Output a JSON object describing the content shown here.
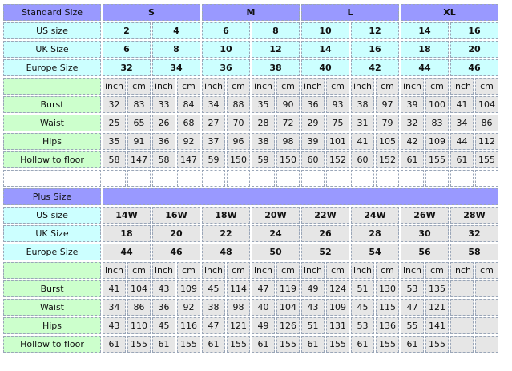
{
  "standard": {
    "title": "Standard Size",
    "groups": [
      "S",
      "M",
      "L",
      "XL"
    ],
    "size_rows": [
      {
        "label": "US size",
        "values": [
          "2",
          "4",
          "6",
          "8",
          "10",
          "12",
          "14",
          "16"
        ]
      },
      {
        "label": "UK Size",
        "values": [
          "6",
          "8",
          "10",
          "12",
          "14",
          "16",
          "18",
          "20"
        ]
      },
      {
        "label": "Europe Size",
        "values": [
          "32",
          "34",
          "36",
          "38",
          "40",
          "42",
          "44",
          "46"
        ]
      }
    ],
    "units": [
      "inch",
      "cm",
      "inch",
      "cm",
      "inch",
      "cm",
      "inch",
      "cm",
      "inch",
      "cm",
      "inch",
      "cm",
      "inch",
      "cm",
      "inch",
      "cm"
    ],
    "measure_rows": [
      {
        "label": "Burst",
        "values": [
          "32",
          "83",
          "33",
          "84",
          "34",
          "88",
          "35",
          "90",
          "36",
          "93",
          "38",
          "97",
          "39",
          "100",
          "41",
          "104"
        ]
      },
      {
        "label": "Waist",
        "values": [
          "25",
          "65",
          "26",
          "68",
          "27",
          "70",
          "28",
          "72",
          "29",
          "75",
          "31",
          "79",
          "32",
          "83",
          "34",
          "86"
        ]
      },
      {
        "label": "Hips",
        "values": [
          "35",
          "91",
          "36",
          "92",
          "37",
          "96",
          "38",
          "98",
          "39",
          "101",
          "41",
          "105",
          "42",
          "109",
          "44",
          "112"
        ]
      },
      {
        "label": "Hollow to floor",
        "values": [
          "58",
          "147",
          "58",
          "147",
          "59",
          "150",
          "59",
          "150",
          "60",
          "152",
          "60",
          "152",
          "61",
          "155",
          "61",
          "155"
        ]
      }
    ]
  },
  "plus": {
    "title": "Plus Size",
    "size_rows": [
      {
        "label": "US size",
        "values": [
          "14W",
          "16W",
          "18W",
          "20W",
          "22W",
          "24W",
          "26W",
          "28W"
        ]
      },
      {
        "label": "UK Size",
        "values": [
          "18",
          "20",
          "22",
          "24",
          "26",
          "28",
          "30",
          "32"
        ]
      },
      {
        "label": "Europe Size",
        "values": [
          "44",
          "46",
          "48",
          "50",
          "52",
          "54",
          "56",
          "58"
        ]
      }
    ],
    "units": [
      "inch",
      "cm",
      "inch",
      "cm",
      "inch",
      "cm",
      "inch",
      "cm",
      "inch",
      "cm",
      "inch",
      "cm",
      "inch",
      "cm",
      "inch",
      "cm"
    ],
    "measure_rows": [
      {
        "label": "Burst",
        "values": [
          "41",
          "104",
          "43",
          "109",
          "45",
          "114",
          "47",
          "119",
          "49",
          "124",
          "51",
          "130",
          "53",
          "135",
          "",
          ""
        ]
      },
      {
        "label": "Waist",
        "values": [
          "34",
          "86",
          "36",
          "92",
          "38",
          "98",
          "40",
          "104",
          "43",
          "109",
          "45",
          "115",
          "47",
          "121",
          "",
          ""
        ]
      },
      {
        "label": "Hips",
        "values": [
          "43",
          "110",
          "45",
          "116",
          "47",
          "121",
          "49",
          "126",
          "51",
          "131",
          "53",
          "136",
          "55",
          "141",
          "",
          ""
        ]
      },
      {
        "label": "Hollow to floor",
        "values": [
          "61",
          "155",
          "61",
          "155",
          "61",
          "155",
          "61",
          "155",
          "61",
          "155",
          "61",
          "155",
          "61",
          "155",
          "",
          ""
        ]
      }
    ]
  },
  "colors": {
    "label_cyan": "#ccffff",
    "label_green": "#ccffcc",
    "header_blue": "#9999ff",
    "cell_gray": "#e6e6e6",
    "border": "#9aa6b8"
  }
}
